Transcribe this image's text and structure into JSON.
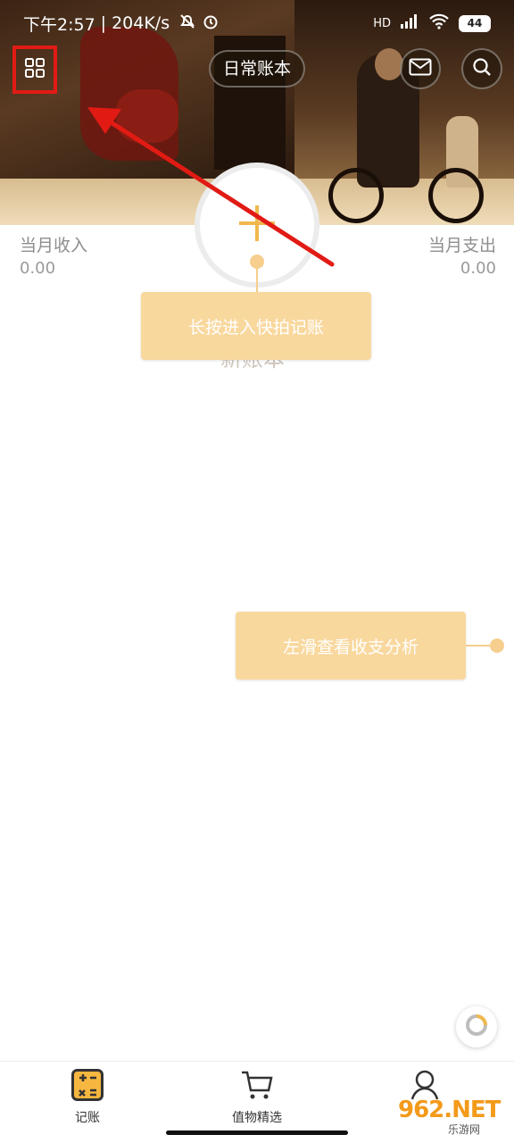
{
  "status_bar": {
    "time": "下午2:57",
    "speed": "204K/s",
    "signal_text": "HD",
    "battery": "44"
  },
  "header": {
    "book_name": "日常账本"
  },
  "summary": {
    "income_label": "当月收入",
    "income_value": "0.00",
    "expense_label": "当月支出",
    "expense_value": "0.00"
  },
  "guide": {
    "tip_long_press": "长按进入快拍记账",
    "ghost_text": "新账本",
    "tip_swipe": "左滑查看收支分析"
  },
  "tabbar": {
    "tabs": [
      {
        "label": "记账"
      },
      {
        "label": "值物精选"
      }
    ]
  },
  "watermark": {
    "main": "962.NET",
    "sub": "乐游网"
  },
  "colors": {
    "accent": "#f9d89e",
    "highlight": "#e11b14",
    "plus": "#f0b84e"
  }
}
